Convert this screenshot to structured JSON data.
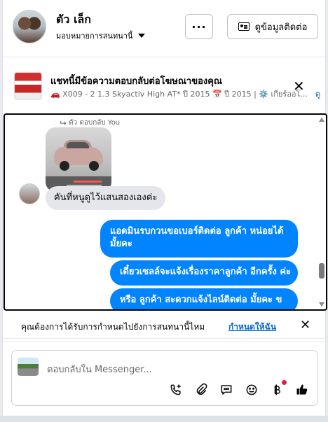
{
  "header": {
    "name": "ตัว เล็ก",
    "assign_label": "มอบหมายการสนทนานี้",
    "more_label": "···",
    "contact_button": "ดูข้อมูลติดต่อ"
  },
  "ad": {
    "title": "แชทนี้มีข้อความตอบกลับต่อโฆษณาของคุณ",
    "subtitle": "🚗 X009 - 2 1.3 Skyactiv High AT* ปี 2015 📅 ปี 2015 | ⚙️ เกียร์ออโ...",
    "link": "ดู"
  },
  "chat": {
    "reply_tag": "ตัว ตอบกลับ You",
    "incoming_message": "คันที่หนูดูไว้แสนสองเองค่ะ",
    "outgoing_messages": [
      "แอดมินรบกวนขอเบอร์ติดต่อ ลูกค้า  หน่อยได้มั้ยคะ",
      "เดี๋ยวเซลล์จะแจ้งเรื่องราคาลูกค้า อีกครั้ง ค่ะ",
      "หรือ  ลูกค้า  สะดวกแจ้งไลน์ติดต่อ มั้ยคะ  ข"
    ]
  },
  "assign_prompt": {
    "question": "คุณต้องการได้รับการกำหนดไปยังการสนทนานี้ไหม",
    "link": "กำหนดให้ฉัน"
  },
  "composer": {
    "placeholder": "ตอบกลับใน Messenger...",
    "icons": [
      "call-plus-icon",
      "attachment-icon",
      "saved-reply-icon",
      "emoji-icon",
      "baht-icon",
      "like-icon"
    ]
  },
  "colors": {
    "accent": "#0084ff",
    "link": "#0064d1",
    "incoming_bubble": "#e4e6eb"
  }
}
